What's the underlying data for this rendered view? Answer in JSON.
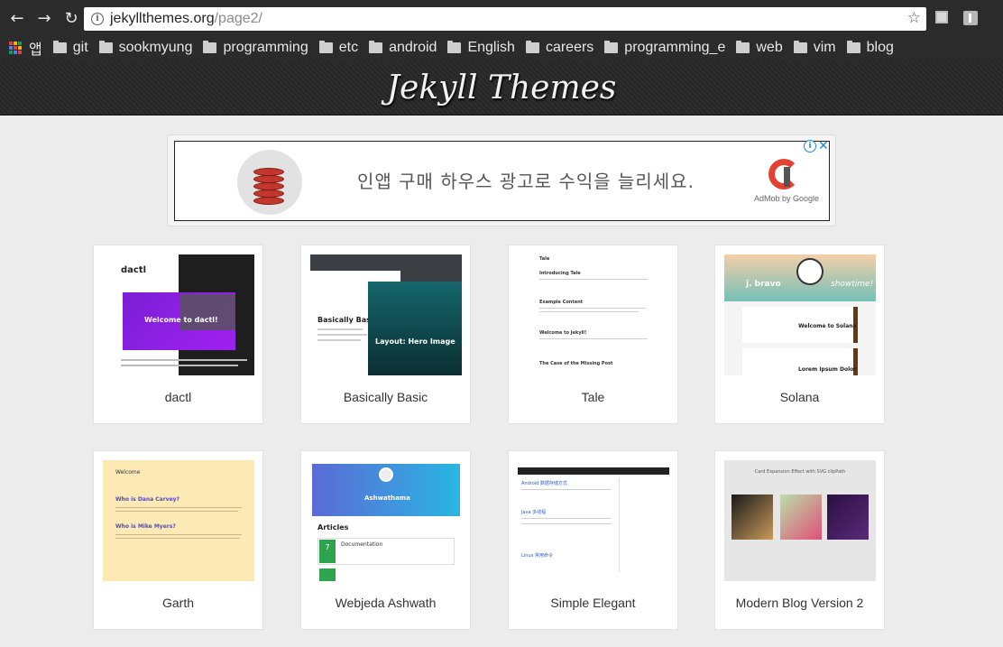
{
  "browser": {
    "url_host": "jekyllthemes.org",
    "url_path": "/page2/",
    "bookmarks": [
      "앱",
      "git",
      "sookmyung",
      "programming",
      "etc",
      "android",
      "English",
      "careers",
      "programming_e",
      "web",
      "vim",
      "blog"
    ]
  },
  "site": {
    "title": "Jekyll Themes"
  },
  "ad": {
    "text": "인앱 구매 하우스 광고로 수익을 늘리세요.",
    "by": "AdMob by Google"
  },
  "themes": [
    {
      "name": "dactl",
      "preview_heading": "Welcome to dactl!",
      "preview_logo": "dactl"
    },
    {
      "name": "Basically Basic",
      "preview_heading": "Basically Basic",
      "preview_sub": "Layout: Hero Image"
    },
    {
      "name": "Tale",
      "preview_logo": "Tale",
      "preview_posts": [
        "Introducing Tale",
        "Example Content",
        "Welcome to Jekyll!",
        "The Case of the Missing Post"
      ]
    },
    {
      "name": "Solana",
      "preview_logo": "j. bravo",
      "preview_tag": "showtime!",
      "preview_posts": [
        "Welcome to Solana",
        "Lorem Ipsum Dolor"
      ]
    },
    {
      "name": "Garth",
      "preview_posts": [
        "Welcome",
        "Who is Dana Carvey?",
        "Who is Mike Myers?"
      ]
    },
    {
      "name": "Webjeda Ashwath",
      "preview_logo": "Ashwathama",
      "preview_section": "Articles",
      "preview_post": "Documentation",
      "preview_day": "7"
    },
    {
      "name": "Simple Elegant",
      "preview_posts": [
        "Android 数据存储方式",
        "Java 多线程",
        "Linux 常用命令"
      ]
    },
    {
      "name": "Modern Blog Version 2",
      "preview_heading": "Card Expansion Effect with SVG clipPath"
    }
  ],
  "colors": {
    "chrome": "#2b2b2b",
    "page_bg": "#ececec",
    "header_bg": "#2a2a2a",
    "ad_brand": "#e34133"
  }
}
